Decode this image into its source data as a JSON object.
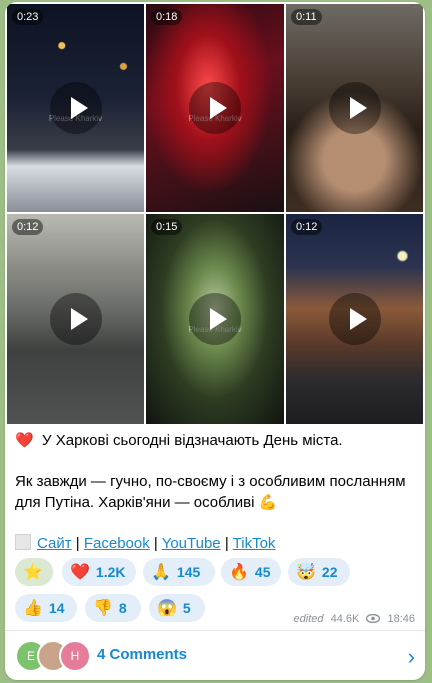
{
  "videos": [
    {
      "duration": "0:23"
    },
    {
      "duration": "0:18"
    },
    {
      "duration": "0:11"
    },
    {
      "duration": "0:12"
    },
    {
      "duration": "0:15"
    },
    {
      "duration": "0:12"
    }
  ],
  "watermark": "Please Kharkiv",
  "post": {
    "line1": "У Харкові сьогодні відзначають День міста.",
    "line2": "Як завжди — гучно, по-своєму і з особливим посланням для Путіна. Харків'яни — особливі",
    "links": [
      "Сайт",
      "Facebook",
      "YouTube",
      "TikTok"
    ],
    "separator": "|"
  },
  "reactions": [
    {
      "emoji": "⭐",
      "count": ""
    },
    {
      "emoji": "❤️",
      "count": "1.2K"
    },
    {
      "emoji": "🙏",
      "count": "145"
    },
    {
      "emoji": "🔥",
      "count": "45"
    },
    {
      "emoji": "🤯",
      "count": "22"
    },
    {
      "emoji": "👍",
      "count": "14"
    },
    {
      "emoji": "👎",
      "count": "8"
    },
    {
      "emoji": "😱",
      "count": "5"
    }
  ],
  "meta": {
    "edited": "edited",
    "views": "44.6K",
    "time": "18:46"
  },
  "comments": {
    "label": "4 Comments",
    "avatars": [
      {
        "initial": "Е",
        "color": "#7cc36e"
      },
      {
        "initial": "",
        "color": "#c9a48a"
      },
      {
        "initial": "Н",
        "color": "#e57c9a"
      }
    ]
  }
}
